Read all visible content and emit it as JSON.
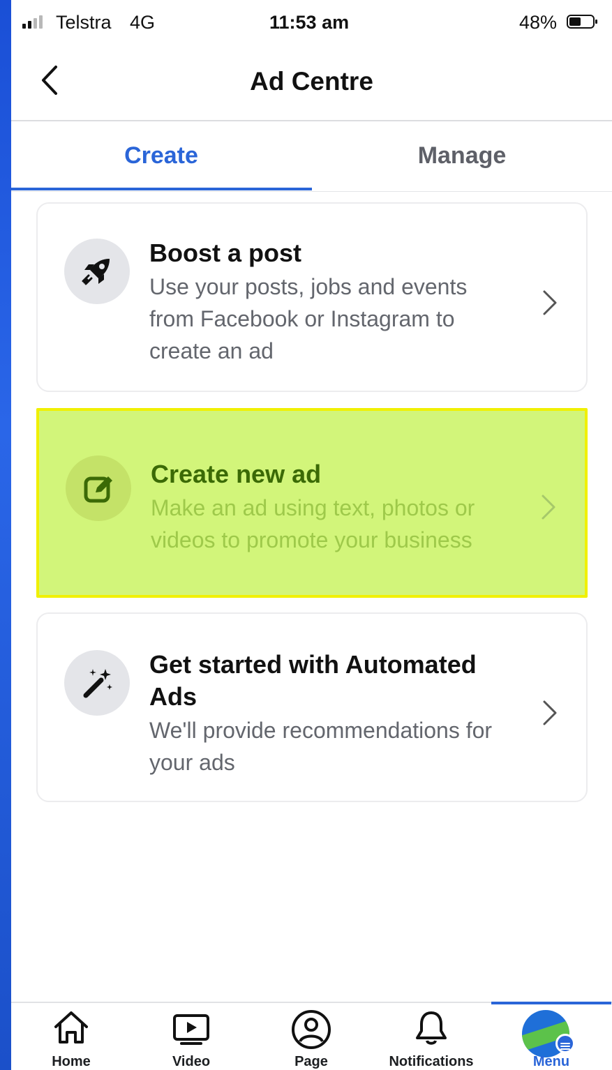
{
  "status_bar": {
    "carrier": "Telstra",
    "network": "4G",
    "time": "11:53 am",
    "battery": "48%",
    "battery_level": 0.48
  },
  "header": {
    "title": "Ad Centre",
    "back_icon": "chevron-left-icon"
  },
  "tabs": [
    {
      "label": "Create",
      "active": true
    },
    {
      "label": "Manage",
      "active": false
    }
  ],
  "cards": [
    {
      "title": "Boost a post",
      "description": "Use your posts, jobs and events from Facebook or Instagram to create an ad",
      "icon": "rocket-icon"
    },
    {
      "title": "Create new ad",
      "description": "Make an ad using text, photos or videos to promote your business",
      "icon": "edit-icon",
      "highlight": "#d2f57a"
    },
    {
      "title": "Get started with Automated Ads",
      "description": "We'll provide recommendations for your ads",
      "icon": "magic-wand-icon"
    }
  ],
  "bottom_nav": [
    {
      "label": "Home",
      "icon": "home-icon"
    },
    {
      "label": "Video",
      "icon": "video-icon"
    },
    {
      "label": "Page",
      "icon": "page-icon"
    },
    {
      "label": "Notifications",
      "icon": "bell-icon"
    },
    {
      "label": "Menu",
      "icon": "avatar",
      "active": true
    }
  ],
  "colors": {
    "accent": "#2a65d8",
    "highlight_border": "#f0f000"
  }
}
